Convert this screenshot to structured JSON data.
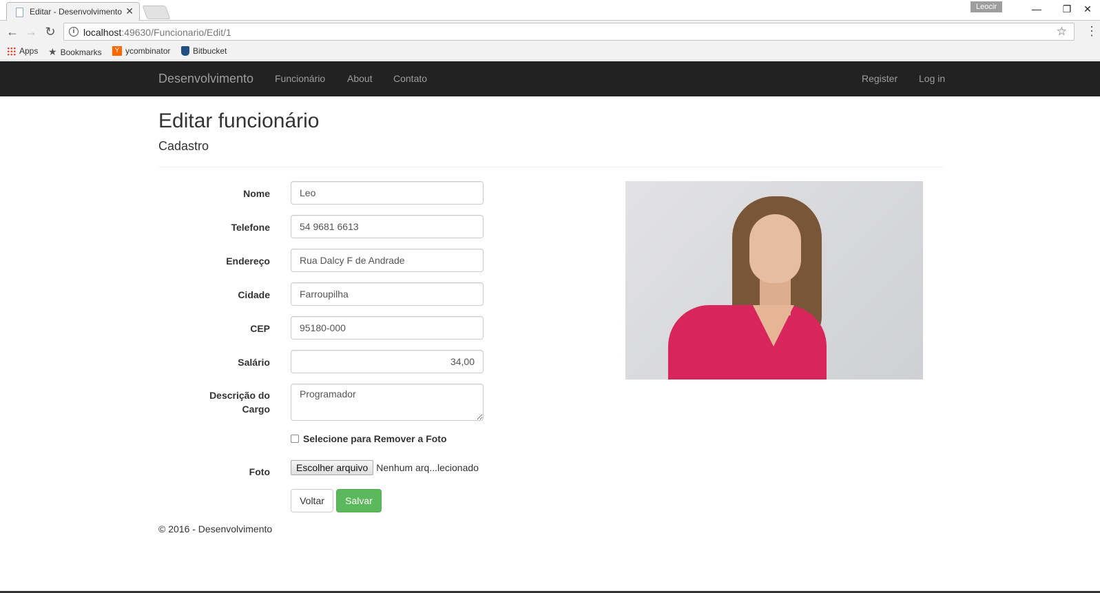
{
  "browser": {
    "tab_title": "Editar - Desenvolvimento",
    "tab_close": "✕",
    "user_badge": "Leocir",
    "url_host": "localhost",
    "url_rest": ":49630/Funcionario/Edit/1",
    "bookmarks": [
      {
        "label": "Apps",
        "icon": "apps-icon"
      },
      {
        "label": "Bookmarks",
        "icon": "star-icon"
      },
      {
        "label": "ycombinator",
        "icon": "ycombinator-icon"
      },
      {
        "label": "Bitbucket",
        "icon": "bitbucket-icon"
      }
    ],
    "yc_letter": "Y"
  },
  "navbar": {
    "brand": "Desenvolvimento",
    "left_links": [
      "Funcionário",
      "About",
      "Contato"
    ],
    "right_links": [
      "Register",
      "Log in"
    ]
  },
  "page": {
    "title": "Editar funcionário",
    "subtitle": "Cadastro"
  },
  "form": {
    "fields": [
      {
        "label": "Nome",
        "value": "Leo"
      },
      {
        "label": "Telefone",
        "value": "54 9681 6613"
      },
      {
        "label": "Endereço",
        "value": "Rua Dalcy F de Andrade"
      },
      {
        "label": "Cidade",
        "value": "Farroupilha"
      },
      {
        "label": "CEP",
        "value": "95180-000"
      },
      {
        "label": "Salário",
        "value": "34,00"
      }
    ],
    "description_label_line1": "Descrição do",
    "description_label_line2": "Cargo",
    "description_value": "Programador",
    "remove_photo_label": "Selecione para Remover a Foto",
    "photo_label": "Foto",
    "file_button": "Escolher arquivo",
    "file_status": "Nenhum arq...lecionado",
    "back_button": "Voltar",
    "save_button": "Salvar"
  },
  "footer": {
    "text": "© 2016 - Desenvolvimento"
  },
  "colors": {
    "navbar_bg": "#222222",
    "navbar_text": "#9d9d9d",
    "success": "#5cb85c"
  }
}
